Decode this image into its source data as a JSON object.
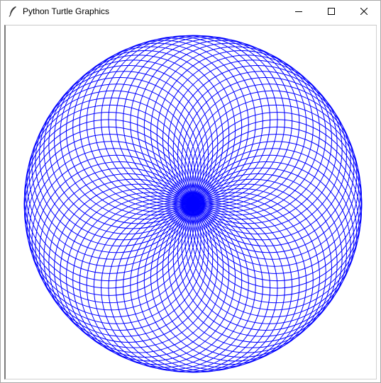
{
  "window": {
    "title": "Python Turtle Graphics",
    "app_icon": "feather-icon",
    "controls": {
      "minimize_icon": "minimize-icon",
      "maximize_icon": "maximize-icon",
      "close_icon": "close-icon"
    }
  },
  "canvas": {
    "background": "#ffffff",
    "pen_color": "#0000ff",
    "pattern": "spirograph of overlapping circles through center",
    "circle_count": 72
  }
}
